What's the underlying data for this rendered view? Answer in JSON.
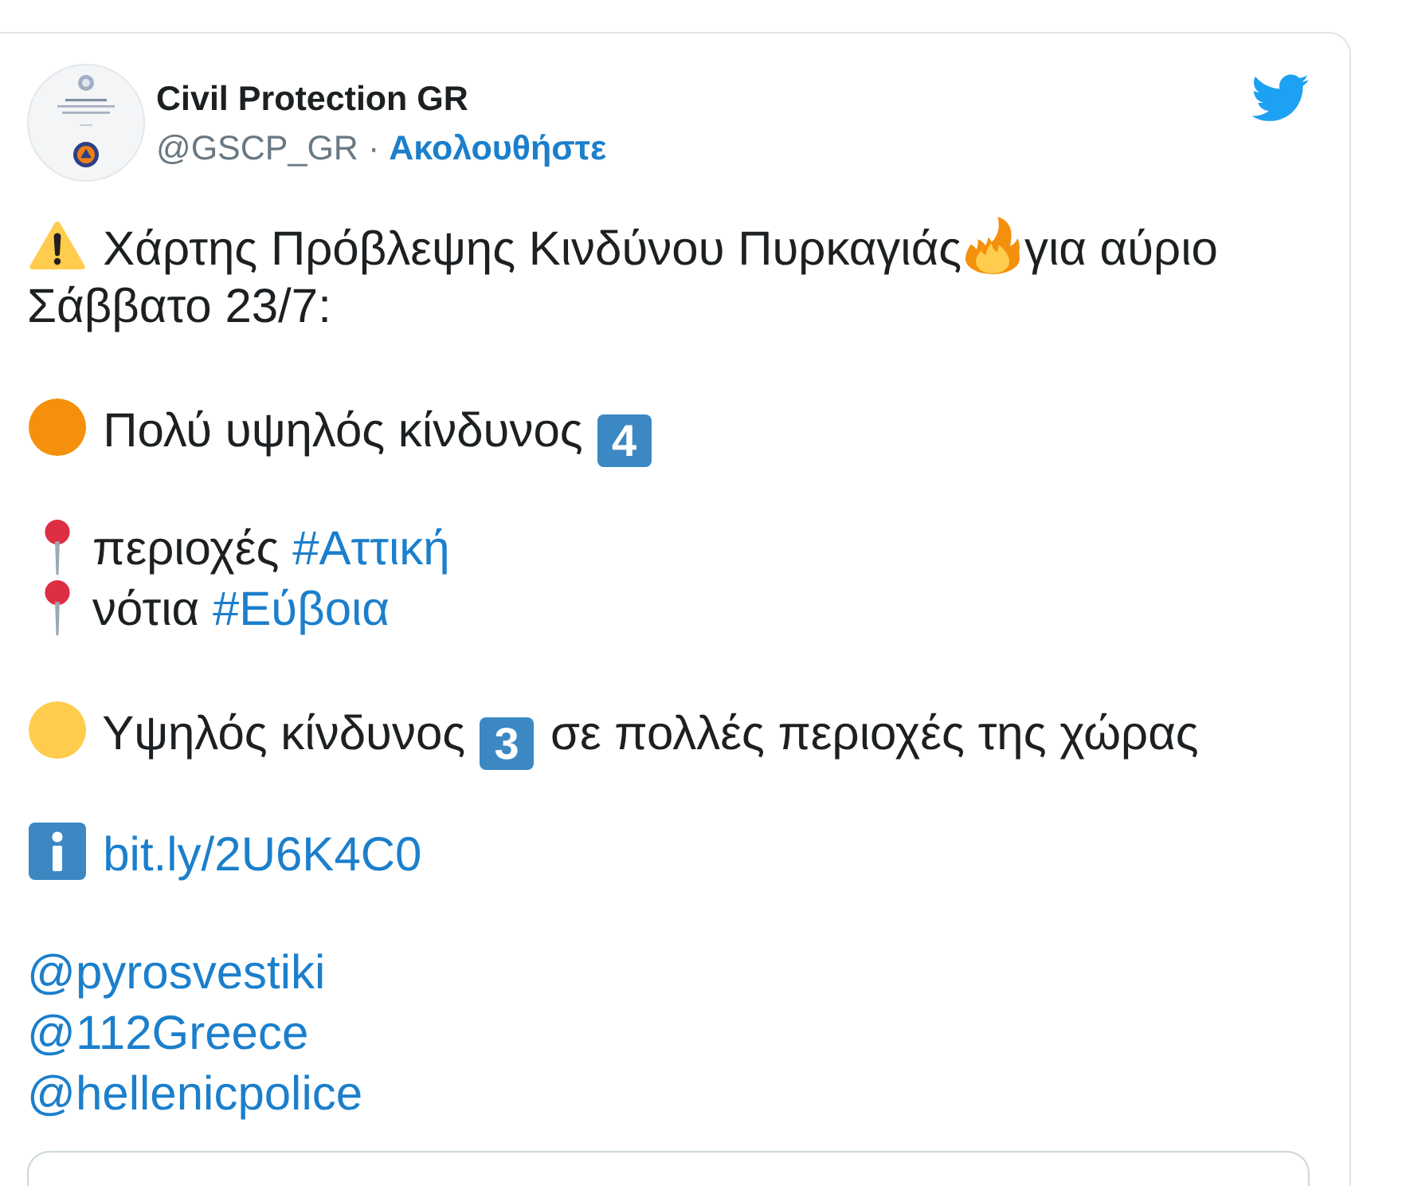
{
  "tweet": {
    "author": {
      "name": "Civil Protection GR",
      "handle": "@GSCP_GR",
      "separator": "·",
      "follow_label": "Ακολουθήστε"
    },
    "paragraphs": [
      {
        "lines": [
          [
            {
              "kind": "warning"
            },
            {
              "kind": "text",
              "text": " Χάρτης Πρόβλεψης Κινδύνου Πυρκαγιάς"
            },
            {
              "kind": "fire"
            },
            {
              "kind": "text",
              "text": "για αύριο"
            }
          ],
          [
            {
              "kind": "text",
              "text": "Σάββατο 23/7:"
            }
          ]
        ]
      },
      {
        "lines": [
          [
            {
              "kind": "dot",
              "color": "#f4900c"
            },
            {
              "kind": "text",
              "text": " Πολύ υψηλός κίνδυνος "
            },
            {
              "kind": "keycap",
              "text": "4"
            }
          ]
        ]
      },
      {
        "lines": [
          [
            {
              "kind": "pin"
            },
            {
              "kind": "text",
              "text": "περιοχές "
            },
            {
              "kind": "hashtag",
              "text": "#Αττική"
            }
          ],
          [
            {
              "kind": "pin"
            },
            {
              "kind": "text",
              "text": "νότια "
            },
            {
              "kind": "hashtag",
              "text": "#Εύβοια"
            }
          ]
        ]
      },
      {
        "lines": [
          [
            {
              "kind": "dot",
              "color": "#ffcc4d"
            },
            {
              "kind": "text",
              "text": " Υψηλός κίνδυνος "
            },
            {
              "kind": "keycap",
              "text": "3"
            },
            {
              "kind": "text",
              "text": " σε πολλές περιοχές της χώρας"
            }
          ]
        ]
      },
      {
        "lines": [
          [
            {
              "kind": "info"
            },
            {
              "kind": "link",
              "text": " bit.ly/2U6K4C0"
            }
          ]
        ]
      },
      {
        "lines": [
          [
            {
              "kind": "mention",
              "text": "@pyrosvestiki"
            }
          ],
          [
            {
              "kind": "mention",
              "text": "@112Greece"
            }
          ],
          [
            {
              "kind": "mention",
              "text": "@hellenicpolice"
            }
          ]
        ]
      }
    ]
  }
}
